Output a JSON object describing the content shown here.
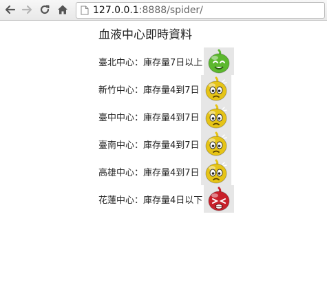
{
  "browser": {
    "url_host": "127.0.0.1",
    "url_rest": ":8888/spider/"
  },
  "page": {
    "title": "血液中心即時資料",
    "centers": [
      {
        "label": "臺北中心：庫存量7日以上",
        "status": "green-happy",
        "color": "#5cb82e"
      },
      {
        "label": "新竹中心：庫存量4到7日",
        "status": "yellow-worried",
        "color": "#e6c417"
      },
      {
        "label": "臺中中心：庫存量4到7日",
        "status": "yellow-worried",
        "color": "#e6c417"
      },
      {
        "label": "臺南中心：庫存量4到7日",
        "status": "yellow-worried",
        "color": "#e6c417"
      },
      {
        "label": "高雄中心：庫存量4到7日",
        "status": "yellow-worried",
        "color": "#e6c417"
      },
      {
        "label": "花蓮中心：庫存量4日以下",
        "status": "red-crying",
        "color": "#c8202a"
      }
    ]
  }
}
